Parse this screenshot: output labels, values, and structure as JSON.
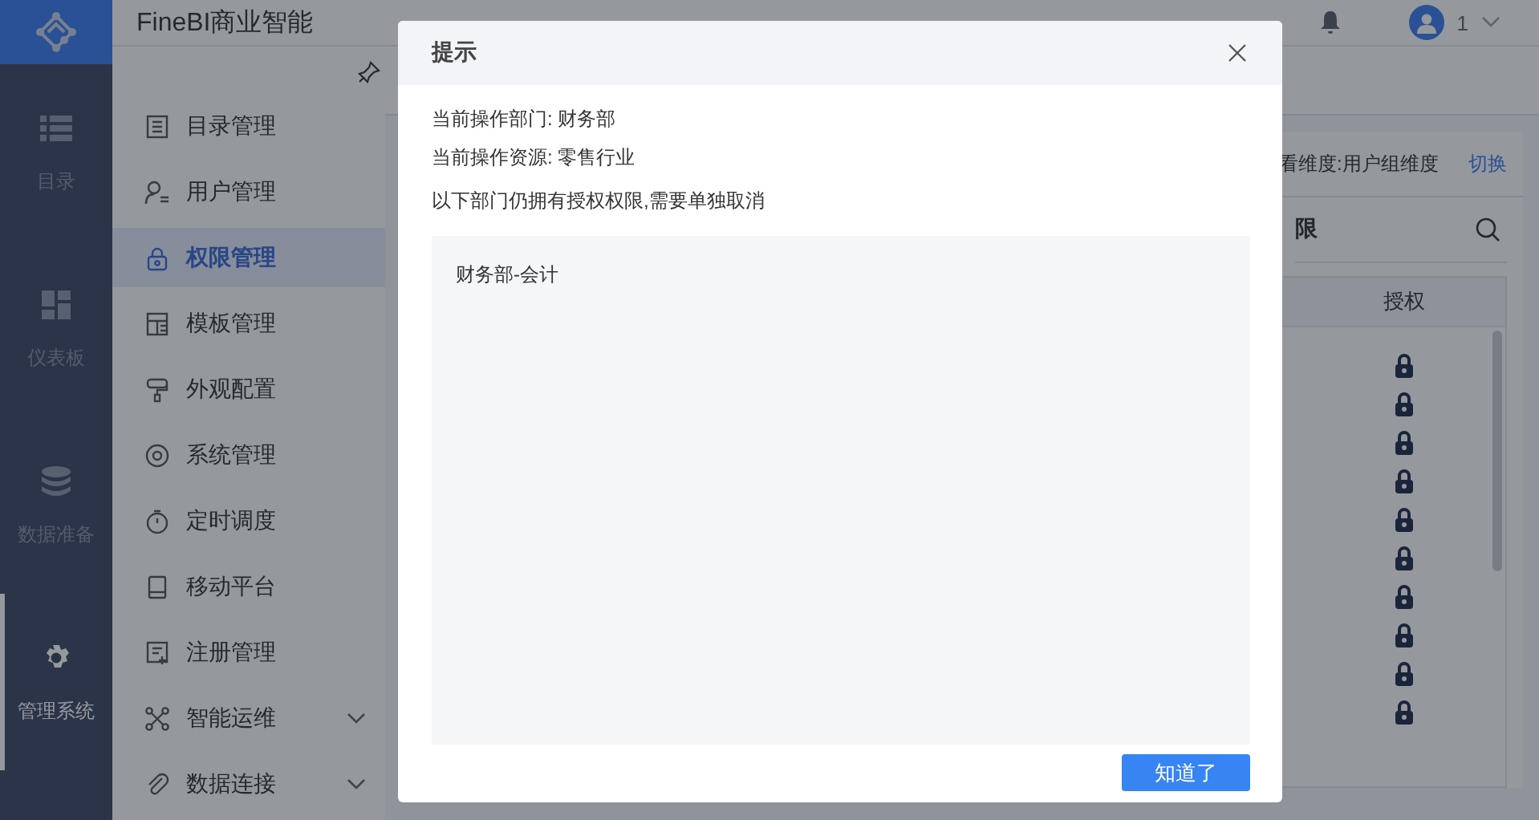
{
  "app": {
    "title": "FineBI商业智能",
    "user": "1"
  },
  "rail": [
    {
      "label": "目录",
      "selected": false
    },
    {
      "label": "仪表板",
      "selected": false
    },
    {
      "label": "数据准备",
      "selected": false
    },
    {
      "label": "管理系统",
      "selected": true
    }
  ],
  "menu": [
    {
      "label": "目录管理",
      "selected": false,
      "expandable": false
    },
    {
      "label": "用户管理",
      "selected": false,
      "expandable": false
    },
    {
      "label": "权限管理",
      "selected": true,
      "expandable": false
    },
    {
      "label": "模板管理",
      "selected": false,
      "expandable": false
    },
    {
      "label": "外观配置",
      "selected": false,
      "expandable": false
    },
    {
      "label": "系统管理",
      "selected": false,
      "expandable": false
    },
    {
      "label": "定时调度",
      "selected": false,
      "expandable": false
    },
    {
      "label": "移动平台",
      "selected": false,
      "expandable": false
    },
    {
      "label": "注册管理",
      "selected": false,
      "expandable": false
    },
    {
      "label": "智能运维",
      "selected": false,
      "expandable": true
    },
    {
      "label": "数据连接",
      "selected": false,
      "expandable": true
    }
  ],
  "panel": {
    "dimension": "看维度:用户组维度",
    "switch": "切换",
    "section": "限",
    "column": "授权",
    "rows": [
      {
        "locked": true
      },
      {
        "locked": true
      },
      {
        "locked": true
      },
      {
        "locked": true
      },
      {
        "locked": true
      },
      {
        "locked": true
      },
      {
        "locked": true
      },
      {
        "locked": true
      },
      {
        "locked": true
      },
      {
        "locked": true
      }
    ]
  },
  "dialog": {
    "title": "提示",
    "lines": [
      "当前操作部门: 财务部",
      "当前操作资源: 零售行业"
    ],
    "notice": "以下部门仍拥有授权权限,需要单独取消",
    "departments": [
      "财务部-会计"
    ],
    "button": "知道了"
  }
}
